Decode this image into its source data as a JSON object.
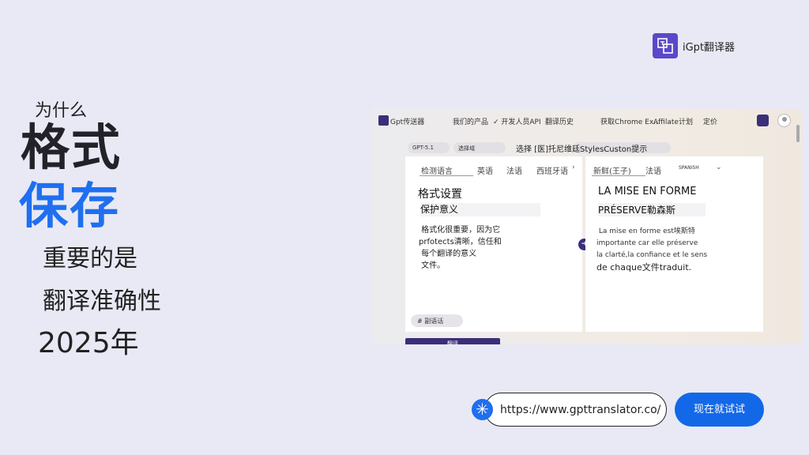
{
  "headline": {
    "small": "为什么",
    "big1": "格式",
    "big2": "保存",
    "line3": "重要的是",
    "line4": "翻译准确性",
    "year": "2025年"
  },
  "brand": {
    "name": "iGpt翻译器",
    "icon": "translate-logo-icon"
  },
  "app": {
    "nav": {
      "name": "Gpt传送器",
      "items": [
        "我们的产品",
        "✓ 开发人员API",
        "翻译历史",
        "获取Chrome Ex...",
        "Affilate计划",
        "定价"
      ]
    },
    "model_pill": "GPT-5.1",
    "choose_pill": "选择域",
    "prompt_label": "选择 [医]托尼维廷",
    "prompt_suffix": "StylesCuston提示",
    "source": {
      "detect": "检测语言",
      "langs": [
        "英语",
        "法语",
        "西班牙语"
      ],
      "title": "格式设置",
      "subtitle": "保护意义",
      "body": " 格式化很重要，因为它\nprfotects清晰，信任和\n 每个翻译的意义\n 文件。",
      "dialect": "# 副语话"
    },
    "target": {
      "lang_active": "新鲜(王子)",
      "lang2": "法语",
      "lang3": "SPANISH",
      "title": "LA MISE EN FORME",
      "subtitle": "PRÉSERVE勒森斯",
      "body_lines": [
        " La mise en forme est埃斯特",
        "importante car elle préserve",
        "la clarté,la confiance et le sens"
      ],
      "body_last": "de chaque文件traduit."
    },
    "translate_button": "翻译"
  },
  "url": "https://www.gpttranslator.co/",
  "cta": "现在就试试",
  "colors": {
    "accent": "#1f6ff0",
    "brand": "#3b2e7a",
    "cta": "#1368e8"
  }
}
